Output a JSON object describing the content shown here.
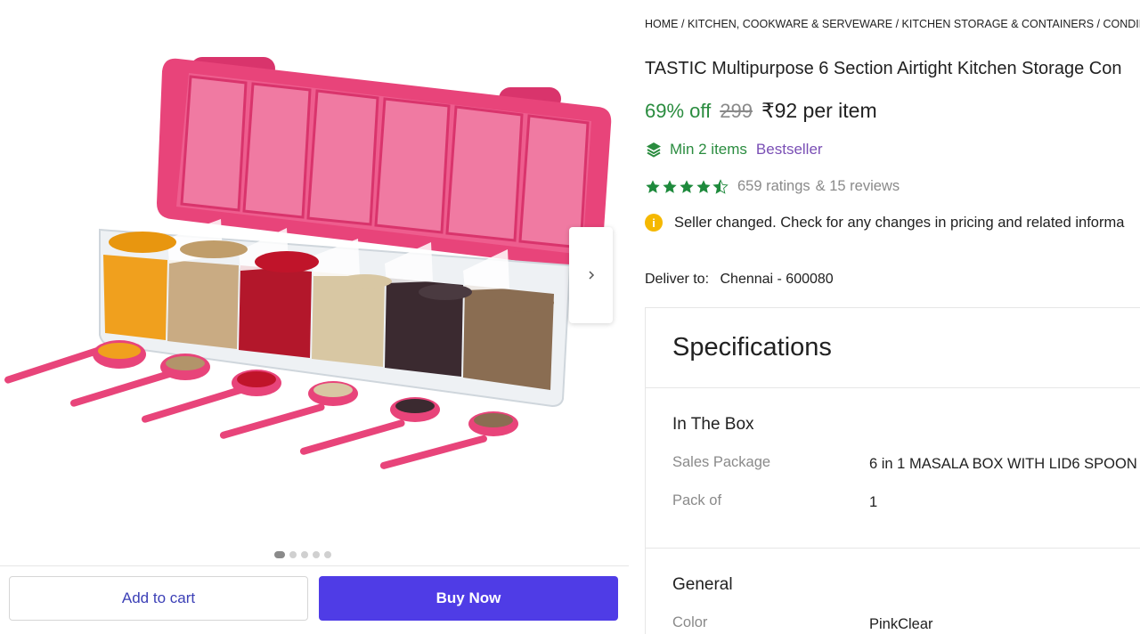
{
  "gallery": {
    "dot_count": 5,
    "active_dot": 0
  },
  "actions": {
    "add_to_cart": "Add to cart",
    "buy_now": "Buy Now"
  },
  "breadcrumb": [
    "HOME",
    "KITCHEN, COOKWARE & SERVEWARE",
    "KITCHEN STORAGE & CONTAINERS",
    "CONDIME"
  ],
  "product": {
    "title": "TASTIC Multipurpose 6 Section Airtight Kitchen Storage Con",
    "discount": "69% off",
    "mrp": "299",
    "price": "₹92 per item",
    "min_items": "Min 2 items",
    "bestseller": "Bestseller",
    "rating_stars": 4.5,
    "ratings": "659 ratings",
    "reviews": "& 15 reviews",
    "notice": "Seller changed. Check for any changes in pricing and related informa"
  },
  "delivery": {
    "label": "Deliver to:",
    "value": "Chennai - 600080"
  },
  "specifications": {
    "title": "Specifications",
    "groups": [
      {
        "title": "In The Box",
        "rows": [
          {
            "label": "Sales Package",
            "value": "6 in 1 MASALA BOX WITH LID6 SPOON"
          },
          {
            "label": "Pack of",
            "value": "1"
          }
        ]
      },
      {
        "title": "General",
        "rows": [
          {
            "label": "Color",
            "value": "PinkClear"
          }
        ]
      }
    ]
  },
  "colors": {
    "accent_green": "#2a8c3f",
    "buy_button": "#4f3ce6",
    "bestseller_purple": "#7a4fb5",
    "lid_pink": "#e8417a"
  }
}
